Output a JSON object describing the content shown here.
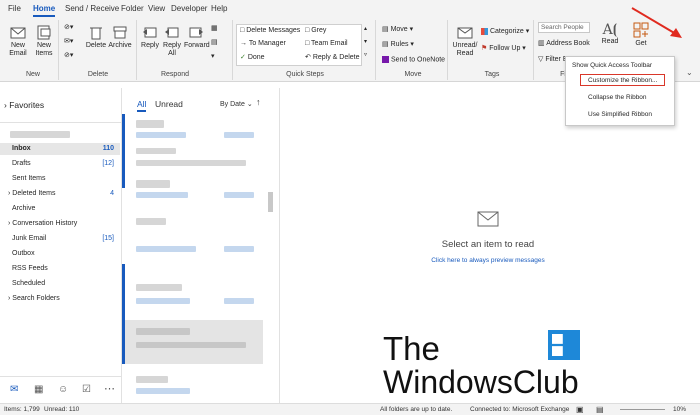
{
  "tabs": [
    "File",
    "Home",
    "Send / Receive",
    "Folder",
    "View",
    "Developer",
    "Help"
  ],
  "ribbon": {
    "new_email": "New Email",
    "new_items": "New Items",
    "delete": "Delete",
    "archive": "Archive",
    "reply": "Reply",
    "reply_all": "Reply All",
    "forward": "Forward",
    "qs_delete_messages": "Delete Messages",
    "qs_to_manager": "To Manager",
    "qs_done": "Done",
    "qs_grey": "Grey",
    "qs_team_email": "Team Email",
    "qs_reply_delete": "Reply & Delete",
    "move": "Move",
    "rules": "Rules",
    "send_onenote": "Send to OneNote",
    "unread_read": "Unread/ Read",
    "categorize": "Categorize",
    "follow_up": "Follow Up",
    "search_people": "Search People",
    "address_book": "Address Book",
    "filter_email": "Filter E",
    "read_aloud": "Read",
    "get": "Get",
    "groups": {
      "new": "New",
      "delete": "Delete",
      "respond": "Respond",
      "quick_steps": "Quick Steps",
      "move": "Move",
      "tags": "Tags",
      "find": "Fi"
    }
  },
  "context_menu": [
    "Show Quick Access Toolbar",
    "Customize the Ribbon...",
    "Collapse the Ribbon",
    "Use Simplified Ribbon"
  ],
  "nav": {
    "favorites": "Favorites",
    "folders": [
      {
        "label": "Inbox",
        "count": "110"
      },
      {
        "label": "Drafts",
        "count": "[12]"
      },
      {
        "label": "Sent Items",
        "count": ""
      },
      {
        "label": "Deleted Items",
        "count": "4"
      },
      {
        "label": "Archive",
        "count": ""
      },
      {
        "label": "Conversation History",
        "count": ""
      },
      {
        "label": "Junk Email",
        "count": "[15]"
      },
      {
        "label": "Outbox",
        "count": ""
      },
      {
        "label": "RSS Feeds",
        "count": ""
      },
      {
        "label": "Scheduled",
        "count": ""
      },
      {
        "label": "Search Folders",
        "count": ""
      }
    ]
  },
  "list": {
    "all": "All",
    "unread": "Unread",
    "sort": "By Date"
  },
  "reading": {
    "title": "Select an item to read",
    "link": "Click here to always preview messages"
  },
  "watermark": {
    "line1": "The",
    "line2": "WindowsClub"
  },
  "status": {
    "items": "Items: 1,799",
    "unread": "Unread: 110",
    "sync": "All folders are up to date.",
    "conn": "Connected to: Microsoft Exchange",
    "zoom": "10%"
  },
  "colors": {
    "accent": "#185abd",
    "highlight_box": "#d9372a",
    "arrow": "#e02a1f"
  }
}
